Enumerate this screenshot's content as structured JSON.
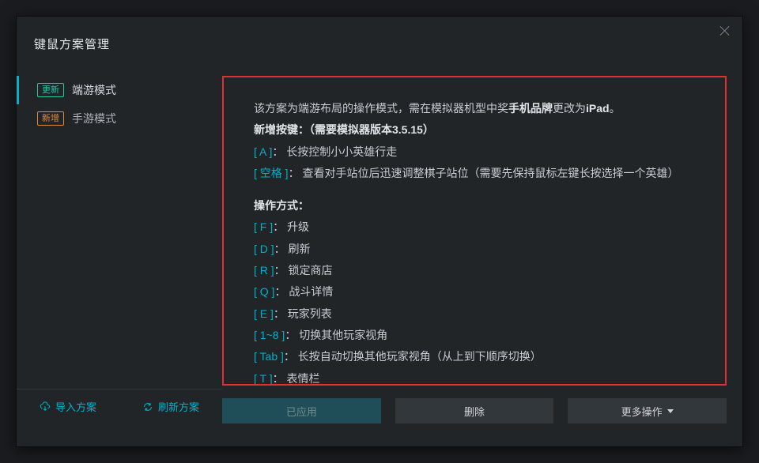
{
  "title": "键鼠方案管理",
  "sidebar": {
    "items": [
      {
        "tag": "更新",
        "tag_kind": "update",
        "label": "端游模式",
        "active": true
      },
      {
        "tag": "新增",
        "tag_kind": "new",
        "label": "手游模式",
        "active": false
      }
    ],
    "import_label": "导入方案",
    "refresh_label": "刷新方案"
  },
  "detail": {
    "intro_prefix": "该方案为端游布局的操作模式，需在模拟器机型中奖",
    "intro_highlight1": "手机品牌",
    "intro_mid": "更改为",
    "intro_highlight2": "iPad",
    "intro_suffix": "。",
    "new_keys_label": "新增按键：",
    "new_keys_note": "（需要模拟器版本3.5.15）",
    "rows1": [
      {
        "key": "[ A ]",
        "desc": "长按控制小小英雄行走"
      },
      {
        "key": "[ 空格 ]",
        "desc": "查看对手站位后迅速调整棋子站位（需要先保持鼠标左键长按选择一个英雄）"
      }
    ],
    "ops_label": "操作方式：",
    "rows2": [
      {
        "key": "[ F ]",
        "desc": "升级"
      },
      {
        "key": "[ D ]",
        "desc": "刷新"
      },
      {
        "key": "[ R ]",
        "desc": "锁定商店"
      },
      {
        "key": "[ Q ]",
        "desc": "战斗详情"
      },
      {
        "key": "[ E ]",
        "desc": "玩家列表"
      },
      {
        "key": "[ 1~8 ]",
        "desc": "切换其他玩家视角"
      },
      {
        "key": "[ Tab ]",
        "desc": "长按自动切换其他玩家视角（从上到下顺序切换）"
      },
      {
        "key": "[ T ]",
        "desc": "表情栏"
      }
    ]
  },
  "actions": {
    "applied": "已应用",
    "delete": "删除",
    "more": "更多操作"
  }
}
